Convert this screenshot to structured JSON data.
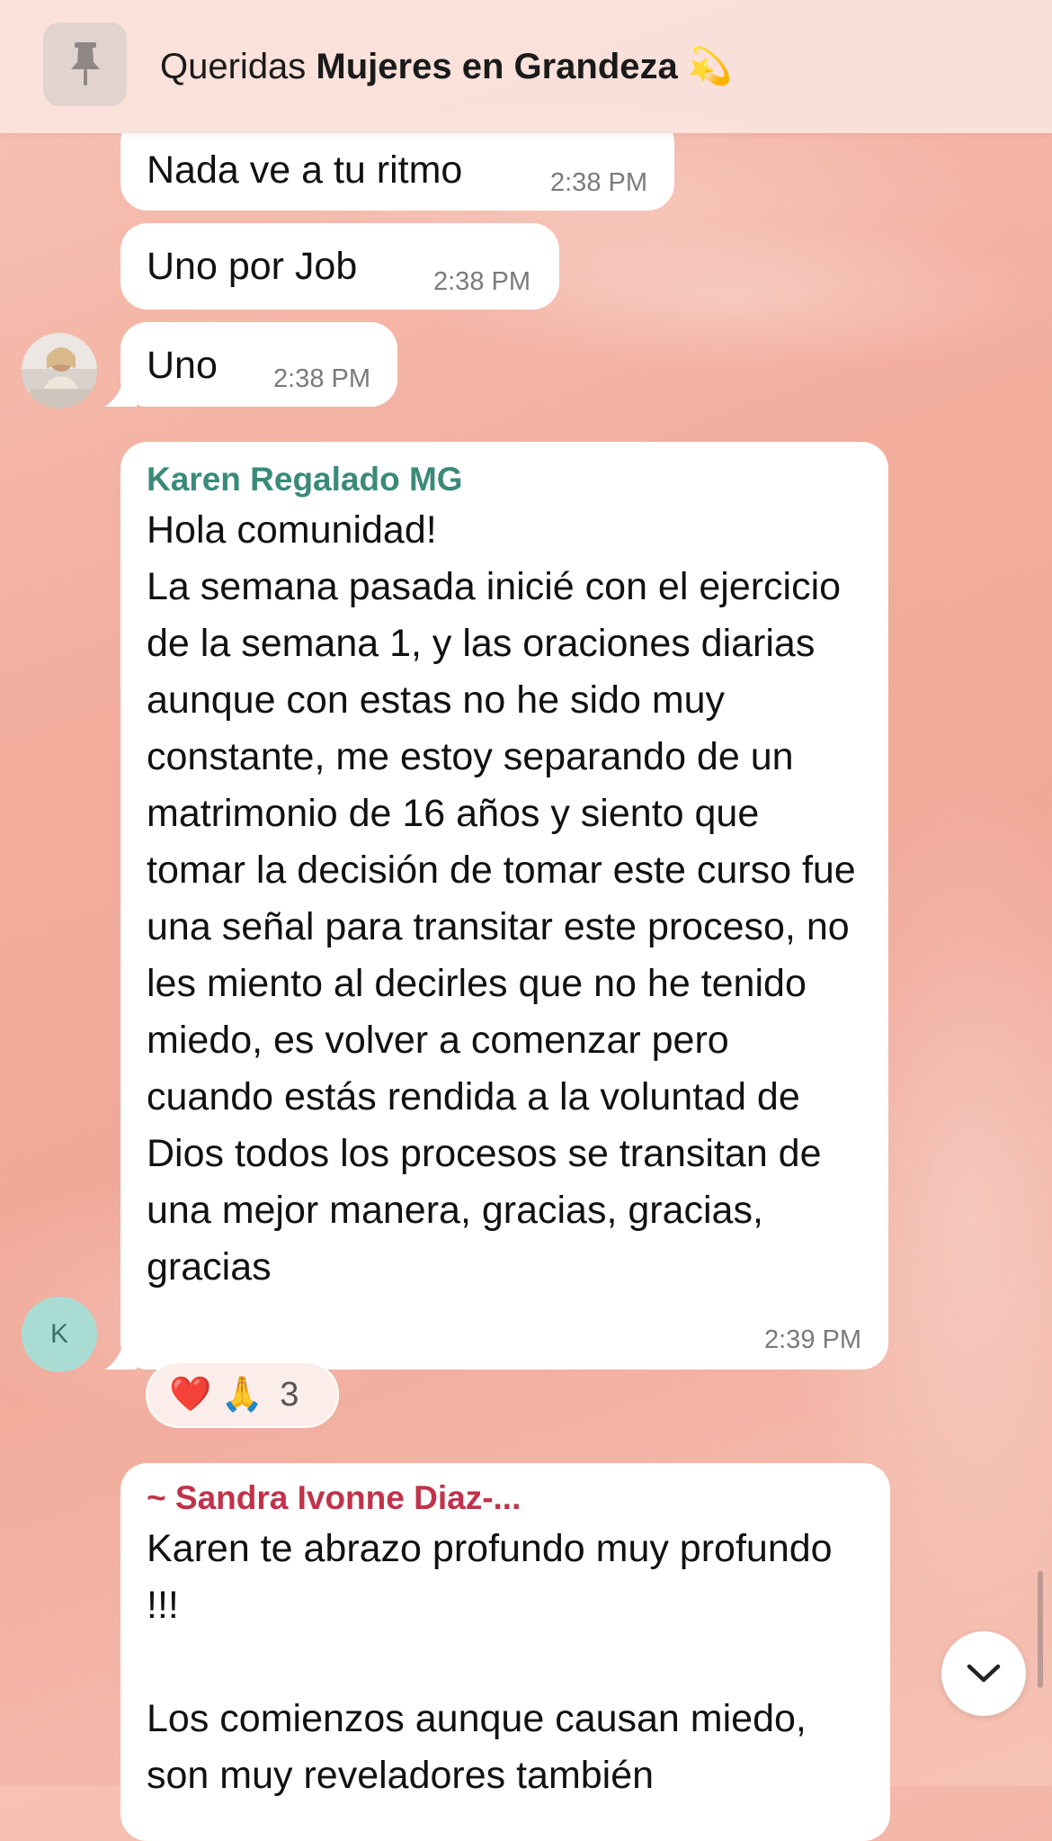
{
  "colors": {
    "background": "#f2ad9d",
    "bubble": "#ffffff",
    "karen_name": "#3b8a79",
    "sandra_name": "#c0334a",
    "timestamp": "#7a7a7a"
  },
  "pinned": {
    "icon": "pin-icon",
    "prefix": "Queridas ",
    "bold": "Mujeres en Grandeza",
    "emoji": "💫"
  },
  "messages": [
    {
      "text": "Nada ve a tu ritmo",
      "time": "2:38 PM"
    },
    {
      "text": "Uno por Job",
      "time": "2:38 PM"
    },
    {
      "text": "Uno",
      "time": "2:38 PM"
    },
    {
      "sender": "Karen Regalado MG",
      "avatar_letter": "K",
      "text": "Hola comunidad!\nLa semana pasada inicié con el ejercicio de la semana 1, y las oraciones diarias aunque con estas no he sido muy constante, me estoy separando de un matrimonio de 16 años y siento que tomar la decisión de tomar este curso fue una señal para transitar este proceso, no les miento al decirles que no he tenido miedo, es volver a comenzar pero cuando estás rendida a la voluntad de Dios todos los procesos se transitan de una mejor manera, gracias, gracias, gracias",
      "time": "2:39 PM",
      "reactions": {
        "emojis": "❤️ 🙏",
        "count": "3"
      }
    },
    {
      "sender": "~ Sandra Ivonne Diaz-...",
      "text": "Karen te abrazo profundo muy profundo !!!\n\nLos comienzos aunque causan miedo, son muy reveladores también"
    }
  ],
  "scroll_down": {
    "icon": "chevron-down-icon"
  }
}
